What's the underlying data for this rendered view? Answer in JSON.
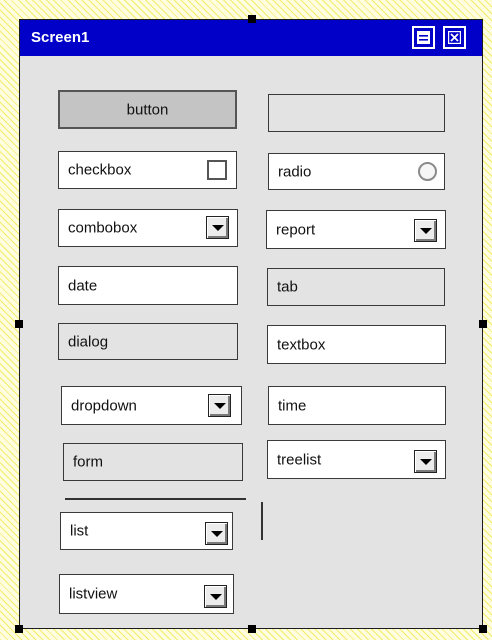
{
  "window": {
    "title": "Screen1",
    "title_bar_color": "#0000c8",
    "buttons": [
      {
        "name": "maximize-icon"
      },
      {
        "name": "close-icon"
      }
    ]
  },
  "widgets": {
    "button": "button",
    "checkbox": "checkbox",
    "combobox": "combobox",
    "date": "date",
    "dialog": "dialog",
    "dropdown": "dropdown",
    "form": "form",
    "list": "list",
    "listview": "listview",
    "empty_label": "",
    "radio": "radio",
    "report": "report",
    "tab": "tab",
    "textbox": "textbox",
    "time": "time",
    "treelist": "treelist"
  },
  "icons": {
    "dropdown_arrow": "chevron-down-icon",
    "resize_handle": "resize-handle"
  }
}
